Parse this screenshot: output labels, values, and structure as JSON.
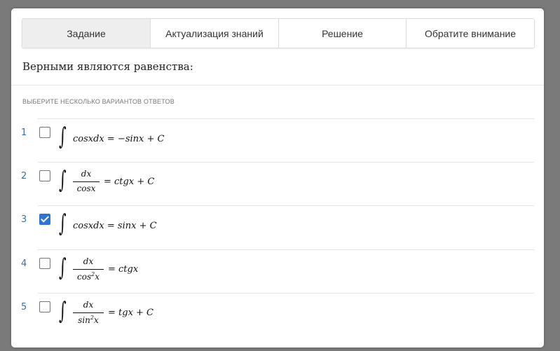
{
  "tabs": [
    {
      "label": "Задание",
      "active": true
    },
    {
      "label": "Актуализация знаний",
      "active": false
    },
    {
      "label": "Решение",
      "active": false
    },
    {
      "label": "Обратите внимание",
      "active": false
    }
  ],
  "question": "Верными являются равенства:",
  "hint": "ВЫБЕРИТЕ НЕСКОЛЬКО ВАРИАНТОВ ОТВЕТОВ",
  "options": [
    {
      "num": "1",
      "checked": false,
      "expr": "cosxdx = −sinx + C"
    },
    {
      "num": "2",
      "checked": false,
      "numerator": "dx",
      "denominator": "cosx",
      "rest": "= ctgx + C"
    },
    {
      "num": "3",
      "checked": true,
      "expr": "cosxdx = sinx + C"
    },
    {
      "num": "4",
      "checked": false,
      "numerator": "dx",
      "denominator": "cos",
      "den_sup": "2",
      "den_tail": "x",
      "rest": "= ctgx"
    },
    {
      "num": "5",
      "checked": false,
      "numerator": "dx",
      "denominator": "sin",
      "den_sup": "2",
      "den_tail": "x",
      "rest": "= tgx + C"
    }
  ],
  "colors": {
    "accent": "#2f72d6",
    "number": "#3b6ea5",
    "active_tab": "#eeeeee"
  }
}
